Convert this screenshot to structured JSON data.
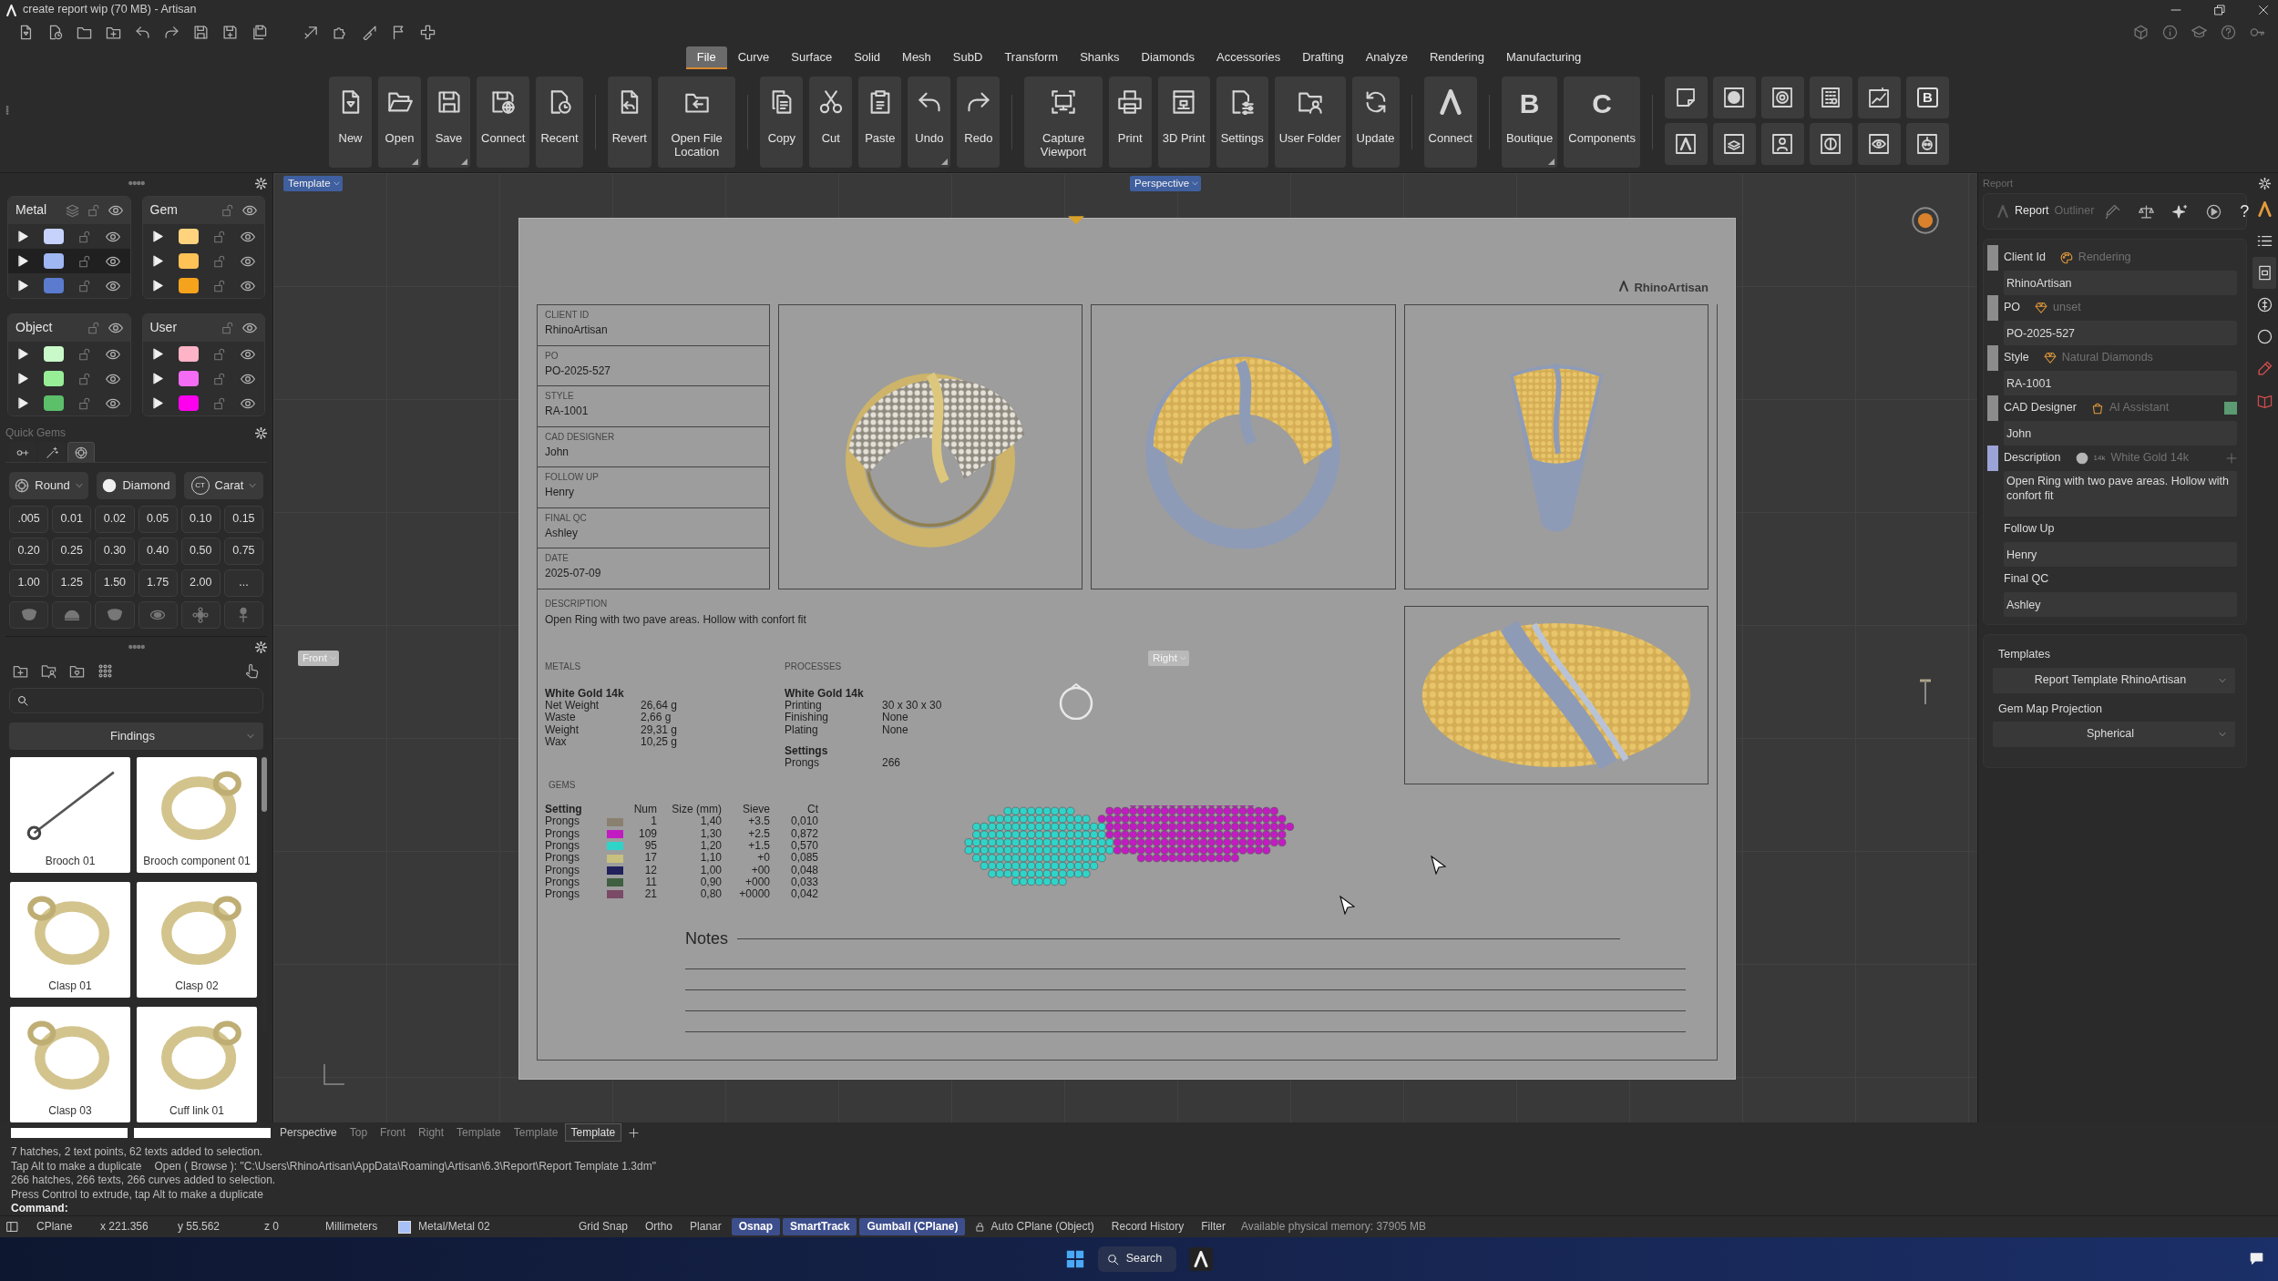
{
  "window": {
    "title": "create report wip (70 MB) - Artisan"
  },
  "ribbon": {
    "tabs": [
      {
        "label": "File",
        "selected": true
      },
      {
        "label": "Curve",
        "selected": false
      },
      {
        "label": "Surface",
        "selected": false
      },
      {
        "label": "Solid",
        "selected": false
      },
      {
        "label": "Mesh",
        "selected": false
      },
      {
        "label": "SubD",
        "selected": false
      },
      {
        "label": "Transform",
        "selected": false
      },
      {
        "label": "Shanks",
        "selected": false
      },
      {
        "label": "Diamonds",
        "selected": false
      },
      {
        "label": "Accessories",
        "selected": false
      },
      {
        "label": "Drafting",
        "selected": false
      },
      {
        "label": "Analyze",
        "selected": false
      },
      {
        "label": "Rendering",
        "selected": false
      },
      {
        "label": "Manufacturing",
        "selected": false
      }
    ],
    "groups": [
      [
        {
          "label": "New",
          "kind": "icon",
          "menu": false
        },
        {
          "label": "Open",
          "kind": "icon",
          "menu": true
        },
        {
          "label": "Save",
          "kind": "icon",
          "menu": true
        },
        {
          "label": "Connect",
          "kind": "icon",
          "menu": false
        },
        {
          "label": "Recent",
          "kind": "icon",
          "menu": false
        }
      ],
      [
        {
          "label": "Revert",
          "kind": "icon",
          "menu": false
        },
        {
          "label": "Open File Location",
          "kind": "icon",
          "menu": false
        }
      ],
      [
        {
          "label": "Copy",
          "kind": "icon",
          "menu": false
        },
        {
          "label": "Cut",
          "kind": "icon",
          "menu": false
        },
        {
          "label": "Paste",
          "kind": "icon",
          "menu": false
        },
        {
          "label": "Undo",
          "kind": "icon",
          "menu": true
        },
        {
          "label": "Redo",
          "kind": "icon",
          "menu": false
        }
      ],
      [
        {
          "label": "Capture Viewport",
          "kind": "icon",
          "menu": false
        },
        {
          "label": "Print",
          "kind": "icon",
          "menu": false
        },
        {
          "label": "3D Print",
          "kind": "icon",
          "menu": false
        },
        {
          "label": "Settings",
          "kind": "icon",
          "menu": false
        },
        {
          "label": "User Folder",
          "kind": "icon",
          "menu": false
        },
        {
          "label": "Update",
          "kind": "icon",
          "menu": false
        }
      ],
      [
        {
          "label": "Connect",
          "kind": "logo",
          "menu": false
        }
      ],
      [
        {
          "label": "Boutique",
          "kind": "glyph",
          "glyph": "B",
          "menu": true
        },
        {
          "label": "Components",
          "kind": "glyph",
          "glyph": "C",
          "menu": false
        }
      ]
    ],
    "icon_grid": [
      {
        "kind": "icon"
      },
      {
        "kind": "icon"
      },
      {
        "kind": "icon"
      },
      {
        "kind": "icon"
      },
      {
        "kind": "icon"
      },
      {
        "kind": "glyph",
        "glyph": "B"
      },
      {
        "kind": "icon"
      },
      {
        "kind": "icon"
      },
      {
        "kind": "icon"
      },
      {
        "kind": "icon"
      },
      {
        "kind": "icon"
      },
      {
        "kind": "icon"
      }
    ]
  },
  "layer_groups": [
    {
      "title": "Metal",
      "rows": [
        {
          "color": "#c6d2fb",
          "selected": false
        },
        {
          "color": "#9fb7f3",
          "selected": true
        },
        {
          "color": "#5b7bcf",
          "selected": false
        }
      ]
    },
    {
      "title": "Gem",
      "rows": [
        {
          "color": "#ffd27d",
          "selected": false
        },
        {
          "color": "#ffc257",
          "selected": false
        },
        {
          "color": "#f5a31c",
          "selected": false
        }
      ]
    },
    {
      "title": "Object",
      "rows": [
        {
          "color": "#c9f9c9",
          "selected": false
        },
        {
          "color": "#97ee97",
          "selected": false
        },
        {
          "color": "#5cbf6a",
          "selected": false
        }
      ]
    },
    {
      "title": "User",
      "rows": [
        {
          "color": "#ffb3c6",
          "selected": false
        },
        {
          "color": "#f36cf3",
          "selected": false
        },
        {
          "color": "#ff00ee",
          "selected": false
        }
      ]
    }
  ],
  "quick_gems": {
    "title": "Quick Gems",
    "tabs": [
      {
        "selected": false
      },
      {
        "selected": false
      },
      {
        "selected": true
      }
    ],
    "dropdowns": [
      {
        "label": "Round",
        "caret": true
      },
      {
        "label": "Diamond",
        "caret": false
      },
      {
        "label": "Carat",
        "glyph": "CT",
        "caret": true
      }
    ],
    "sizes": [
      ".005",
      "0.01",
      "0.02",
      "0.05",
      "0.10",
      "0.15",
      "0.20",
      "0.25",
      "0.30",
      "0.40",
      "0.50",
      "0.75",
      "1.00",
      "1.25",
      "1.50",
      "1.75",
      "2.00",
      "..."
    ]
  },
  "library": {
    "category": "Findings",
    "items": [
      {
        "label": "Brooch 01"
      },
      {
        "label": "Brooch component 01"
      },
      {
        "label": "Clasp 01"
      },
      {
        "label": "Clasp 02"
      },
      {
        "label": "Clasp 03"
      },
      {
        "label": "Cuff link 01"
      }
    ]
  },
  "viewport": {
    "labels": [
      {
        "label": "Template",
        "active": true
      },
      {
        "label": "Perspective",
        "active": true
      },
      {
        "label": "Front",
        "active": false
      },
      {
        "label": "Right",
        "active": false
      }
    ],
    "tabs": [
      {
        "label": "Perspective",
        "selected": false
      },
      {
        "label": "Top",
        "selected": false
      },
      {
        "label": "Front",
        "selected": false
      },
      {
        "label": "Right",
        "selected": false
      },
      {
        "label": "Template",
        "selected": false
      },
      {
        "label": "Template",
        "selected": false
      },
      {
        "label": "Template",
        "selected": true
      }
    ]
  },
  "report": {
    "logo": "RhinoArtisan",
    "info": [
      {
        "label": "CLIENT ID",
        "value": "RhinoArtisan"
      },
      {
        "label": "PO",
        "value": "PO-2025-527"
      },
      {
        "label": "STYLE",
        "value": "RA-1001"
      },
      {
        "label": "CAD DESIGNER",
        "value": "John"
      },
      {
        "label": "FOLLOW UP",
        "value": "Henry"
      },
      {
        "label": "FINAL QC",
        "value": "Ashley"
      },
      {
        "label": "DATE",
        "value": "2025-07-09"
      }
    ],
    "description": {
      "label": "DESCRIPTION",
      "text": "Open Ring with two pave areas. Hollow with confort fit"
    },
    "metals": {
      "heading": "METALS",
      "name": "White Gold 14k",
      "rows": [
        {
          "label": "Net Weight",
          "value": "26,64 g"
        },
        {
          "label": "Waste",
          "value": "2,66 g"
        },
        {
          "label": "Weight",
          "value": "29,31 g"
        },
        {
          "label": "Wax",
          "value": "10,25 g"
        }
      ]
    },
    "processes": {
      "heading": "PROCESSES",
      "name": "White Gold 14k",
      "rows": [
        {
          "label": "Printing",
          "value": "30 x 30 x 30"
        },
        {
          "label": "Finishing",
          "value": "None"
        },
        {
          "label": "Plating",
          "value": "None"
        }
      ],
      "settings": {
        "name": "Settings",
        "rows": [
          {
            "label": "Prongs",
            "value": "266"
          }
        ]
      }
    },
    "gems": {
      "heading": "GEMS",
      "columns": [
        "Setting",
        "Num",
        "Size (mm)",
        "Sieve",
        "Ct"
      ],
      "rows": [
        {
          "setting": "Prongs",
          "color": "#8a8070",
          "num": "1",
          "size": "1,40",
          "sieve": "+3.5",
          "ct": "0,010"
        },
        {
          "setting": "Prongs",
          "color": "#c21bc2",
          "num": "109",
          "size": "1,30",
          "sieve": "+2.5",
          "ct": "0,872"
        },
        {
          "setting": "Prongs",
          "color": "#2fd4c9",
          "num": "95",
          "size": "1,20",
          "sieve": "+1.5",
          "ct": "0,570"
        },
        {
          "setting": "Prongs",
          "color": "#c8c07e",
          "num": "17",
          "size": "1,10",
          "sieve": "+0",
          "ct": "0,085"
        },
        {
          "setting": "Prongs",
          "color": "#22215c",
          "num": "12",
          "size": "1,00",
          "sieve": "+00",
          "ct": "0,048"
        },
        {
          "setting": "Prongs",
          "color": "#3f5f41",
          "num": "11",
          "size": "0,90",
          "sieve": "+000",
          "ct": "0,033"
        },
        {
          "setting": "Prongs",
          "color": "#7a4a66",
          "num": "21",
          "size": "0,80",
          "sieve": "+0000",
          "ct": "0,042"
        }
      ]
    },
    "notes": {
      "title": "Notes"
    }
  },
  "report_panel": {
    "title": "Report",
    "toolbar_label": "Report",
    "toolbar_ghost": "Outliner",
    "help": "?",
    "fields": [
      {
        "label": "Client Id",
        "value": "RhinoArtisan",
        "kind": "input"
      },
      {
        "label": "PO",
        "value": "PO-2025-527",
        "kind": "input"
      },
      {
        "label": "Style",
        "value": "RA-1001",
        "kind": "input"
      },
      {
        "label": "CAD Designer",
        "value": "John",
        "kind": "input"
      },
      {
        "label": "Description",
        "value": "Open Ring with two pave areas. Hollow with confort fit",
        "kind": "textarea"
      },
      {
        "label": "Follow Up",
        "value": "Henry",
        "kind": "input"
      },
      {
        "label": "Final QC",
        "value": "Ashley",
        "kind": "input"
      }
    ],
    "faded_menu": [
      {
        "label": "Rendering",
        "color": "#8c8c8c"
      },
      {
        "label": "unset",
        "color": "#8c8c8c"
      },
      {
        "label": "Natural Diamonds",
        "color": "#8c8c8c"
      },
      {
        "label": "AI Assistant",
        "color": "#8c8c8c",
        "swatch": {
          "color": "#5b9a72"
        }
      },
      {
        "label": "White Gold 14k",
        "color": "#9ca3d6",
        "badge": "14k",
        "add": true
      }
    ],
    "templates": {
      "label": "Templates",
      "value": "Report Template RhinoArtisan"
    },
    "projection": {
      "label": "Gem Map Projection",
      "value": "Spherical"
    }
  },
  "side_strip": [
    {
      "selected": false
    },
    {
      "selected": false
    },
    {
      "selected": true
    },
    {
      "selected": false
    },
    {
      "selected": false
    },
    {
      "selected": false
    },
    {
      "selected": false
    }
  ],
  "command": {
    "history": [
      [
        "7 hatches, 2 text points, 62 texts added to selection."
      ],
      [
        "Tap Alt to make a duplicate",
        "Open ( Browse ): \"C:\\Users\\RhinoArtisan\\AppData\\Roaming\\Artisan\\6.3\\Report\\Report Template 1.3dm\""
      ],
      [
        "266 hatches, 266 texts, 266 curves added to selection."
      ],
      [
        "Press Control to extrude, tap Alt to make a duplicate"
      ]
    ],
    "prompt": "Command:"
  },
  "status_bar": {
    "cplane": "CPlane",
    "x": "x 221.356",
    "y": "y 55.562",
    "z": "z 0",
    "units": "Millimeters",
    "layer": {
      "label": "Metal/Metal 02",
      "color": "#a8c0f8"
    },
    "toggles": [
      {
        "label": "Grid Snap",
        "on": false,
        "kind": "toggle"
      },
      {
        "label": "Ortho",
        "on": false,
        "kind": "toggle"
      },
      {
        "label": "Planar",
        "on": false,
        "kind": "toggle"
      },
      {
        "label": "Osnap",
        "on": true,
        "kind": "toggle"
      },
      {
        "label": "SmartTrack",
        "on": true,
        "kind": "toggle"
      },
      {
        "label": "Gumball (CPlane)",
        "on": true,
        "kind": "toggle"
      },
      {
        "label": "Auto CPlane (Object)",
        "on": false,
        "kind": "lock"
      },
      {
        "label": "Record History",
        "on": false,
        "kind": "toggle"
      },
      {
        "label": "Filter",
        "on": false,
        "kind": "toggle"
      }
    ],
    "memory": "Available physical memory: 37905 MB"
  },
  "taskbar": {
    "search": "Search"
  }
}
